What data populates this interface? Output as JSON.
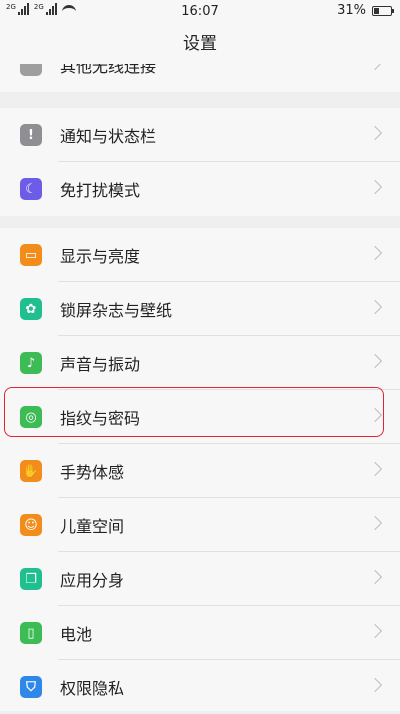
{
  "status_bar": {
    "signal1_label": "2G",
    "signal2_label": "2G",
    "time": "16:07",
    "battery": "31%",
    "battery_level": 0.31
  },
  "header": {
    "title": "设置"
  },
  "sections": [
    {
      "items": [
        {
          "label": "其他无线连接",
          "icon": "wireless-icon",
          "color": "#9e9e9e"
        }
      ]
    },
    {
      "items": [
        {
          "label": "通知与状态栏",
          "icon": "notification-icon",
          "color": "#8e8e93"
        },
        {
          "label": "免打扰模式",
          "icon": "moon-icon",
          "color": "#6c5ce7"
        }
      ]
    },
    {
      "items": [
        {
          "label": "显示与亮度",
          "icon": "display-icon",
          "color": "#f28c1b"
        },
        {
          "label": "锁屏杂志与壁纸",
          "icon": "flower-icon",
          "color": "#1fbf8f"
        },
        {
          "label": "声音与振动",
          "icon": "speaker-icon",
          "color": "#3dbb55"
        },
        {
          "label": "指纹与密码",
          "icon": "fingerprint-icon",
          "color": "#3dbb55"
        },
        {
          "label": "手势体感",
          "icon": "hand-icon",
          "color": "#f28c1b"
        },
        {
          "label": "儿童空间",
          "icon": "child-icon",
          "color": "#f28c1b"
        },
        {
          "label": "应用分身",
          "icon": "clone-icon",
          "color": "#1fbf8f"
        },
        {
          "label": "电池",
          "icon": "battery-icon",
          "color": "#3dbb55"
        },
        {
          "label": "权限隐私",
          "icon": "shield-icon",
          "color": "#2f88e8"
        }
      ]
    }
  ]
}
